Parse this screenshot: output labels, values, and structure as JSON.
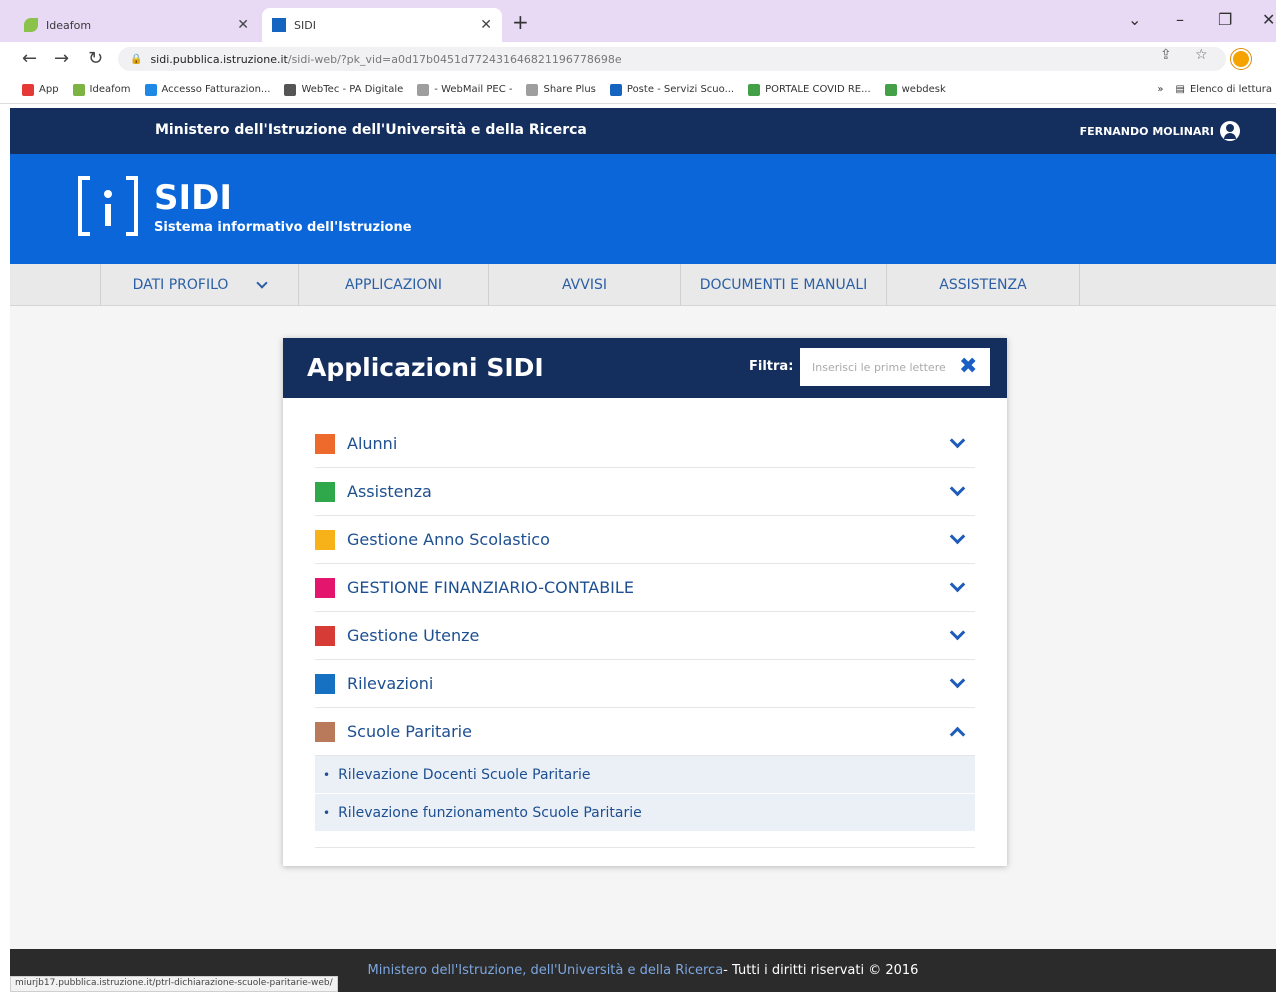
{
  "browser": {
    "tabs": [
      {
        "label": "Ideafom",
        "active": false
      },
      {
        "label": "SIDI",
        "active": true
      }
    ],
    "url_host": "sidi.pubblica.istruzione.it",
    "url_path": "/sidi-web/?pk_vid=a0d17b0451d772431646821196778698e",
    "bookmarks": [
      {
        "label": "App",
        "color": "#e53935"
      },
      {
        "label": "Ideafom",
        "color": "#7cb342"
      },
      {
        "label": "Accesso Fatturazion...",
        "color": "#1e88e5"
      },
      {
        "label": "WebTec - PA Digitale",
        "color": "#555555"
      },
      {
        "label": "- WebMail PEC -",
        "color": "#9e9e9e"
      },
      {
        "label": "Share Plus",
        "color": "#9e9e9e"
      },
      {
        "label": "Poste - Servizi Scuo...",
        "color": "#1565c0"
      },
      {
        "label": "PORTALE COVID RE...",
        "color": "#43a047"
      },
      {
        "label": "webdesk",
        "color": "#43a047"
      }
    ],
    "reading_list": "Elenco di lettura",
    "status_url": "miurjb17.pubblica.istruzione.it/ptrl-dichiarazione-scuole-paritarie-web/"
  },
  "site": {
    "ministero": "Ministero dell'Istruzione dell'Università e della Ricerca",
    "user": "FERNANDO MOLINARI",
    "logo_title": "SIDI",
    "logo_subtitle": "Sistema informativo dell'Istruzione",
    "menu": [
      "DATI PROFILO",
      "APPLICAZIONI",
      "AVVISI",
      "DOCUMENTI E MANUALI",
      "ASSISTENZA"
    ]
  },
  "panel": {
    "title": "Applicazioni SIDI",
    "filter_label": "Filtra:",
    "filter_placeholder": "Inserisci le prime lettere",
    "items": [
      {
        "label": "Alunni",
        "color": "#ee6a2c",
        "expanded": false
      },
      {
        "label": "Assistenza",
        "color": "#2ea84a",
        "expanded": false
      },
      {
        "label": "Gestione Anno Scolastico",
        "color": "#f7b21a",
        "expanded": false
      },
      {
        "label": "GESTIONE FINANZIARIO-CONTABILE",
        "color": "#e3156d",
        "expanded": false
      },
      {
        "label": "Gestione Utenze",
        "color": "#d63b35",
        "expanded": false
      },
      {
        "label": "Rilevazioni",
        "color": "#1671c2",
        "expanded": false
      },
      {
        "label": "Scuole Paritarie",
        "color": "#b87a5a",
        "expanded": true
      }
    ],
    "subitems": [
      "Rilevazione Docenti Scuole Paritarie",
      "Rilevazione funzionamento Scuole Paritarie"
    ]
  },
  "footer": {
    "link": "Ministero dell'Istruzione, dell'Università e della Ricerca",
    "rights": " - Tutti i diritti riservati © 2016"
  }
}
